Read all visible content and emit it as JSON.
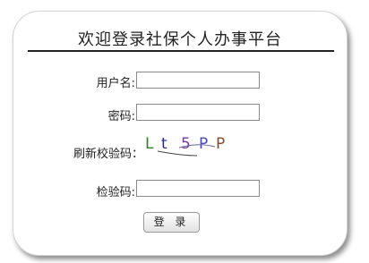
{
  "title": "欢迎登录社保个人办事平台",
  "form": {
    "username_label": "用户名:",
    "password_label": "密码:",
    "refresh_captcha_label": "刷新校验码：",
    "verify_label": "检验码:",
    "username_value": "",
    "password_value": "",
    "verify_value": ""
  },
  "captcha": {
    "chars": [
      "L",
      "t",
      "5",
      "P",
      "P"
    ],
    "colors": [
      "#3a7a2a",
      "#2a2a9a",
      "#7a3a9a",
      "#4a4ab0",
      "#8a4a2a"
    ]
  },
  "login_button_label": "登 录"
}
